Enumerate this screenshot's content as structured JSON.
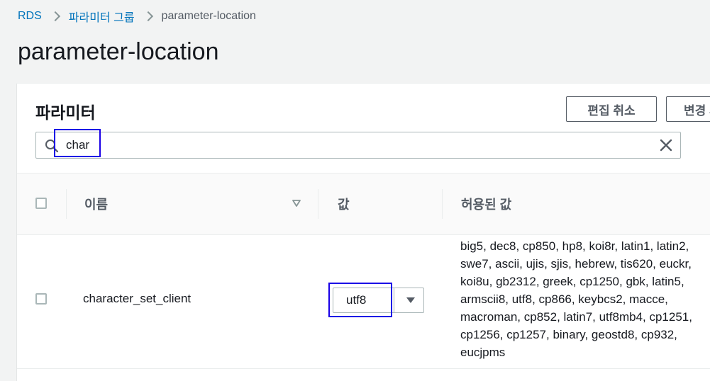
{
  "breadcrumb": {
    "items": [
      "RDS",
      "파라미터 그룹",
      "parameter-location"
    ]
  },
  "page": {
    "title": "parameter-location"
  },
  "panel": {
    "title": "파라미터",
    "buttons": {
      "cancel_label": "편집 취소",
      "save_label": "변경 사항 저장"
    }
  },
  "search": {
    "value": "char",
    "search_icon": "search-icon",
    "clear_icon": "close-icon"
  },
  "table": {
    "headers": {
      "name": "이름",
      "value": "값",
      "allowed": "허용된 값"
    },
    "rows": [
      {
        "name": "character_set_client",
        "value": "utf8",
        "allowed": "big5, dec8, cp850, hp8, koi8r, latin1, latin2, swe7, ascii, ujis, sjis, hebrew, tis620, euckr, koi8u, gb2312, greek, cp1250, gbk, latin5, armscii8, utf8, cp866, keybcs2, macce, macroman, cp852, latin7, utf8mb4, cp1251, cp1256, cp1257, binary, geostd8, cp932, eucjpms"
      }
    ]
  },
  "colors": {
    "link": "#0073bb",
    "highlight": "#1a00e6",
    "background": "#f2f3f3"
  }
}
